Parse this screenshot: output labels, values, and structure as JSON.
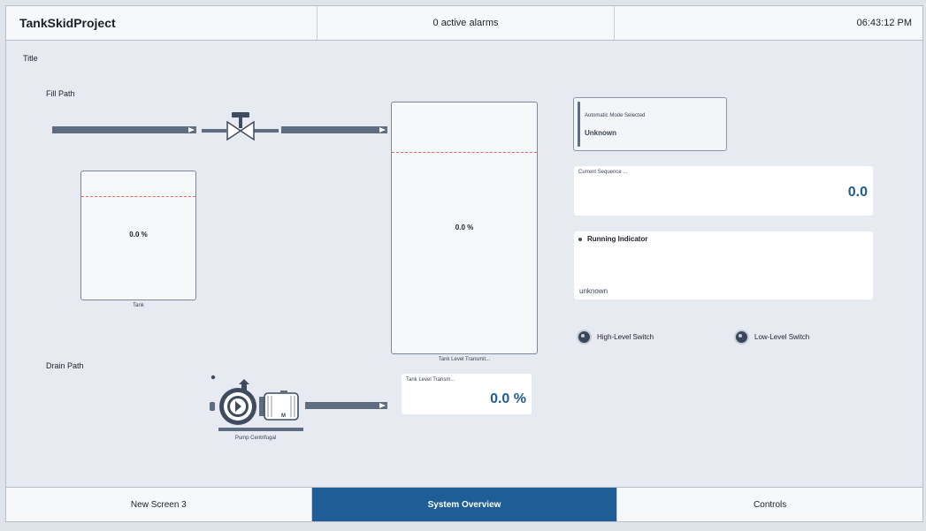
{
  "header": {
    "project_name": "TankSkidProject",
    "alarms_text": "0 active alarms",
    "time": "06:43:12 PM"
  },
  "screen": {
    "title": "Title",
    "fill_path_label": "Fill Path",
    "drain_path_label": "Drain Path"
  },
  "tank_small": {
    "value": "0.0 %",
    "caption": "Tank"
  },
  "tank_large": {
    "value": "0.0 %",
    "caption": "Tank Level Transmit..."
  },
  "pump": {
    "caption": "Pump Centrifugal",
    "motor_letter": "M"
  },
  "level_card": {
    "label": "Tank Level Transm...",
    "value": "0.0 %"
  },
  "mode_card": {
    "label": "Automatic Mode Selected",
    "value": "Unknown"
  },
  "sequence_card": {
    "label": "Current Sequence ...",
    "value": "0.0"
  },
  "running_card": {
    "label": "Running Indicator",
    "value": "unknown"
  },
  "switches": {
    "high": "High-Level Switch",
    "low": "Low-Level Switch"
  },
  "footer": {
    "tabs": [
      "New Screen 3",
      "System Overview",
      "Controls"
    ],
    "active_index": 1
  },
  "colors": {
    "accent": "#1f5d96",
    "pipe": "#5f6d82",
    "setpoint_line": "#e2685a"
  }
}
